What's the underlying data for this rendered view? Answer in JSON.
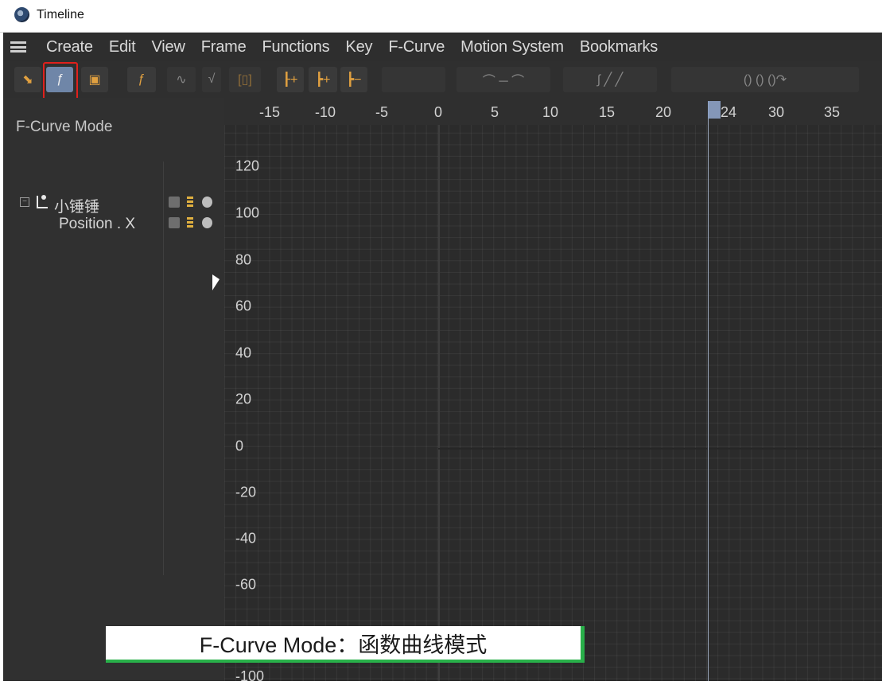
{
  "window": {
    "title": "Timeline"
  },
  "menu": [
    "Create",
    "Edit",
    "View",
    "Frame",
    "Functions",
    "Key",
    "F-Curve",
    "Motion System",
    "Bookmarks"
  ],
  "panel": {
    "mode_label": "F-Curve Mode",
    "tracks": [
      {
        "label": "小锤锤",
        "type": "object"
      },
      {
        "label": "Position . X",
        "type": "track"
      }
    ]
  },
  "graph": {
    "x_ticks": [
      "-15",
      "-10",
      "-5",
      "0",
      "5",
      "10",
      "15",
      "20",
      "24",
      "30",
      "35"
    ],
    "y_ticks": [
      "120",
      "100",
      "80",
      "60",
      "40",
      "20",
      "0",
      "-20",
      "-40",
      "-60",
      "-100"
    ],
    "current_frame": "24"
  },
  "caption": "F-Curve Mode：函数曲线模式",
  "colors": {
    "highlight": "#e0201c",
    "accent": "#29b04a",
    "key_icon": "#e0a040"
  }
}
